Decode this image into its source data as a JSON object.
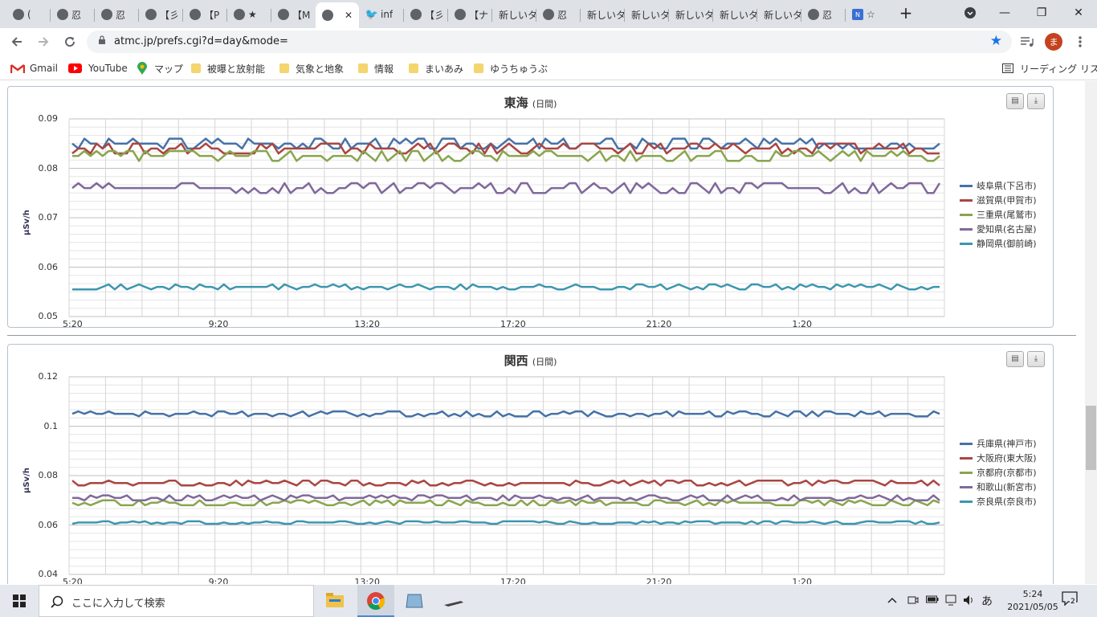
{
  "browser": {
    "tabs": [
      {
        "label": "(",
        "icon": "globe-icon"
      },
      {
        "label": "忍",
        "icon": "globe-icon"
      },
      {
        "label": "忍",
        "icon": "globe-icon"
      },
      {
        "label": "【彡",
        "icon": "globe-icon"
      },
      {
        "label": "【P",
        "icon": "globe-icon"
      },
      {
        "label": "★",
        "icon": "globe-icon"
      },
      {
        "label": "【M",
        "icon": "globe-icon"
      },
      {
        "label": "",
        "icon": "globe-icon",
        "active": true
      },
      {
        "label": "inf",
        "icon": "twitter-icon"
      },
      {
        "label": "【彡",
        "icon": "globe-icon"
      },
      {
        "label": "【ナ",
        "icon": "globe-icon"
      },
      {
        "label": "新しいタ",
        "icon": ""
      },
      {
        "label": "忍",
        "icon": "globe-icon"
      },
      {
        "label": "新しいタ",
        "icon": ""
      },
      {
        "label": "新しいタ",
        "icon": ""
      },
      {
        "label": "新しいタ",
        "icon": ""
      },
      {
        "label": "新しいタ",
        "icon": ""
      },
      {
        "label": "新しいタ",
        "icon": ""
      },
      {
        "label": "忍",
        "icon": "globe-icon"
      },
      {
        "label": "☆",
        "icon": "notion-icon"
      }
    ],
    "url": "atmc.jp/prefs.cgi?d=day&mode=",
    "profile_initial": "ま",
    "bookmarks": [
      "Gmail",
      "YouTube",
      "マップ",
      "被曝と放射能",
      "気象と地象",
      "情報",
      "まいあみ",
      "ゆうちゅうぶ"
    ],
    "reading_list": "リーディング リスト"
  },
  "charts": [
    {
      "title": "東海",
      "subtitle": "(日間)",
      "y_axis_title": "μSv/h",
      "y_ticks": [
        "0.09",
        "0.08",
        "0.07",
        "0.06",
        "0.05"
      ],
      "x_ticks": [
        "5:20",
        "9:20",
        "13:20",
        "17:20",
        "21:20",
        "1:20"
      ],
      "legend": [
        "岐阜県(下呂市)",
        "滋賀県(甲賀市)",
        "三重県(尾鷲市)",
        "愛知県(名古屋)",
        "静岡県(御前崎)"
      ]
    },
    {
      "title": "関西",
      "subtitle": "(日間)",
      "y_axis_title": "μSv/h",
      "y_ticks": [
        "0.12",
        "0.1",
        "0.08",
        "0.06",
        "0.04"
      ],
      "x_ticks": [
        "5:20",
        "9:20",
        "13:20",
        "17:20",
        "21:20",
        "1:20"
      ],
      "legend": [
        "兵庫県(神戸市)",
        "大阪府(東大阪)",
        "京都府(京都市)",
        "和歌山(新宮市)",
        "奈良県(奈良市)"
      ]
    }
  ],
  "chart_data": [
    {
      "type": "line",
      "title": "東海",
      "subtitle": "(日間)",
      "ylabel": "μSv/h",
      "ylim": [
        0.05,
        0.09
      ],
      "x_range": [
        "5:20",
        "5:10"
      ],
      "grid": true,
      "legend_position": "right",
      "series": [
        {
          "name": "岐阜県(下呂市)",
          "color": "#4572a7",
          "base": 0.085,
          "jitter": 0.001
        },
        {
          "name": "滋賀県(甲賀市)",
          "color": "#aa4643",
          "base": 0.084,
          "jitter": 0.001
        },
        {
          "name": "三重県(尾鷲市)",
          "color": "#89a54e",
          "base": 0.0825,
          "jitter": 0.001
        },
        {
          "name": "愛知県(名古屋)",
          "color": "#80699b",
          "base": 0.076,
          "jitter": 0.001
        },
        {
          "name": "静岡県(御前崎)",
          "color": "#3d96ae",
          "base": 0.056,
          "jitter": 0.0005
        }
      ]
    },
    {
      "type": "line",
      "title": "関西",
      "subtitle": "(日間)",
      "ylabel": "μSv/h",
      "ylim": [
        0.04,
        0.12
      ],
      "x_range": [
        "5:20",
        "5:10"
      ],
      "grid": true,
      "legend_position": "right",
      "series": [
        {
          "name": "兵庫県(神戸市)",
          "color": "#4572a7",
          "base": 0.105,
          "jitter": 0.001
        },
        {
          "name": "大阪府(東大阪)",
          "color": "#aa4643",
          "base": 0.077,
          "jitter": 0.001
        },
        {
          "name": "京都府(京都市)",
          "color": "#89a54e",
          "base": 0.069,
          "jitter": 0.001
        },
        {
          "name": "和歌山(新宮市)",
          "color": "#80699b",
          "base": 0.071,
          "jitter": 0.001
        },
        {
          "name": "奈良県(奈良市)",
          "color": "#3d96ae",
          "base": 0.061,
          "jitter": 0.0005
        }
      ]
    }
  ],
  "taskbar": {
    "search_placeholder": "ここに入力して検索",
    "time": "5:24",
    "date": "2021/05/05",
    "notifications": "2",
    "ime": "あ"
  }
}
